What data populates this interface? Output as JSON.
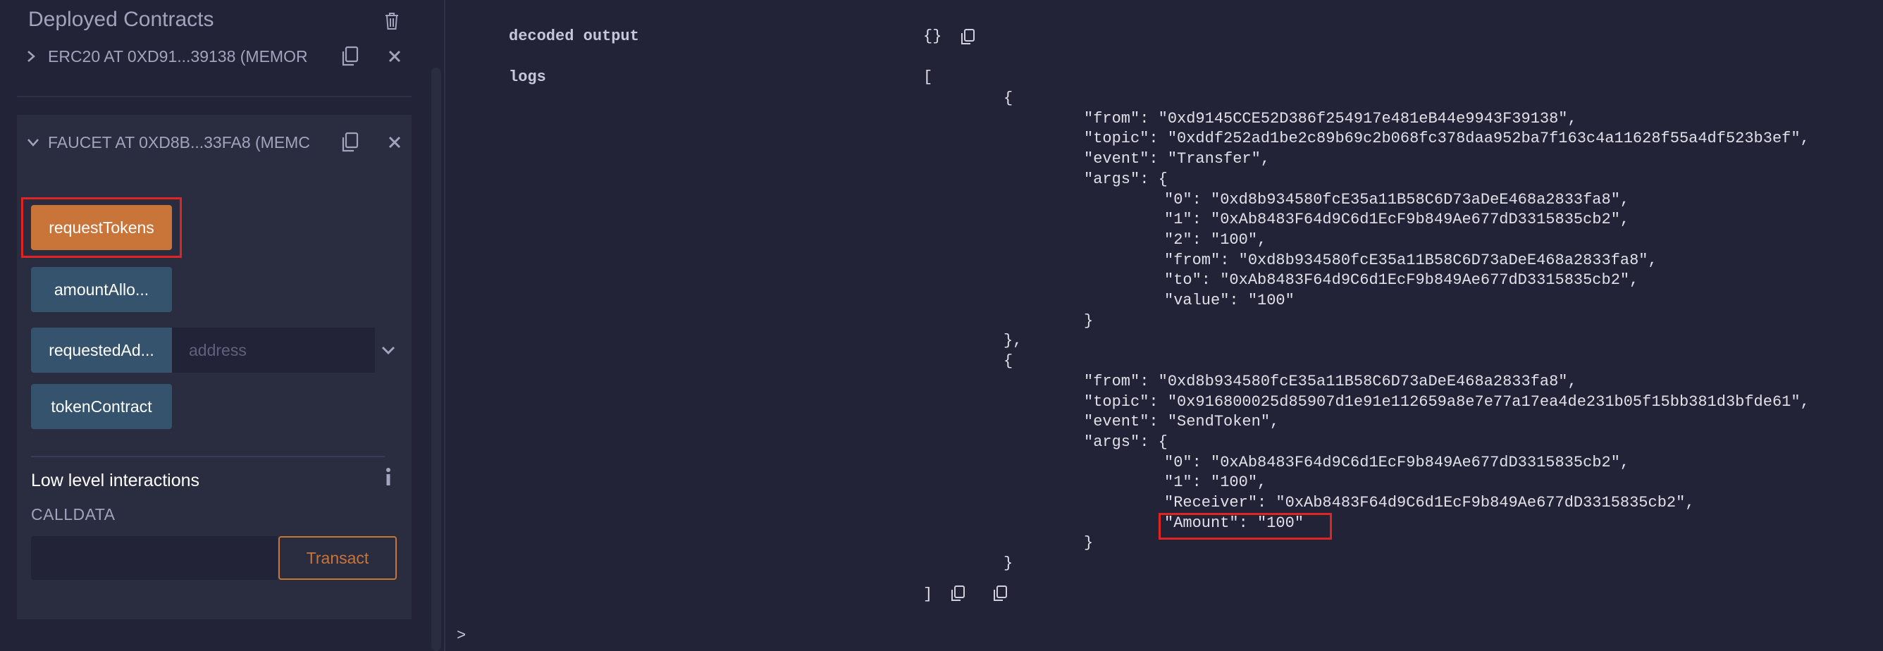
{
  "sidebar": {
    "title": "Deployed Contracts",
    "contracts": [
      {
        "label": "ERC20 AT 0XD91...39138 (MEMOR",
        "expanded": false
      },
      {
        "label": "FAUCET AT 0XD8B...33FA8 (MEMC",
        "expanded": true
      }
    ],
    "functions": [
      {
        "label": "requestTokens",
        "color": "orange",
        "highlighted": true
      },
      {
        "label": "amountAllo...",
        "color": "blue"
      },
      {
        "label": "requestedAd...",
        "color": "blue",
        "input_placeholder": "address"
      },
      {
        "label": "tokenContract",
        "color": "blue"
      }
    ],
    "low_level": {
      "title": "Low level interactions",
      "calldata_label": "CALLDATA",
      "transact_label": "Transact"
    }
  },
  "terminal": {
    "decoded_output_label": "decoded output",
    "decoded_output_value": "{}",
    "logs_label": "logs",
    "logs_open": "[",
    "logs_close": "]",
    "prompt": ">",
    "lines": [
      {
        "indent": 1,
        "text": "{"
      },
      {
        "indent": 2,
        "text": "\"from\": \"0xd9145CCE52D386f254917e481eB44e9943F39138\","
      },
      {
        "indent": 2,
        "text": "\"topic\": \"0xddf252ad1be2c89b69c2b068fc378daa952ba7f163c4a11628f55a4df523b3ef\","
      },
      {
        "indent": 2,
        "text": "\"event\": \"Transfer\","
      },
      {
        "indent": 2,
        "text": "\"args\": {"
      },
      {
        "indent": 3,
        "text": "\"0\": \"0xd8b934580fcE35a11B58C6D73aDeE468a2833fa8\","
      },
      {
        "indent": 3,
        "text": "\"1\": \"0xAb8483F64d9C6d1EcF9b849Ae677dD3315835cb2\","
      },
      {
        "indent": 3,
        "text": "\"2\": \"100\","
      },
      {
        "indent": 3,
        "text": "\"from\": \"0xd8b934580fcE35a11B58C6D73aDeE468a2833fa8\","
      },
      {
        "indent": 3,
        "text": "\"to\": \"0xAb8483F64d9C6d1EcF9b849Ae677dD3315835cb2\","
      },
      {
        "indent": 3,
        "text": "\"value\": \"100\""
      },
      {
        "indent": 2,
        "text": "}"
      },
      {
        "indent": 1,
        "text": "},"
      },
      {
        "indent": 1,
        "text": "{"
      },
      {
        "indent": 2,
        "text": "\"from\": \"0xd8b934580fcE35a11B58C6D73aDeE468a2833fa8\","
      },
      {
        "indent": 2,
        "text": "\"topic\": \"0x916800025d85907d1e91e112659a8e7e77a17ea4de231b05f15bb381d3bfde61\","
      },
      {
        "indent": 2,
        "text": "\"event\": \"SendToken\","
      },
      {
        "indent": 2,
        "text": "\"args\": {"
      },
      {
        "indent": 3,
        "text": "\"0\": \"0xAb8483F64d9C6d1EcF9b849Ae677dD3315835cb2\","
      },
      {
        "indent": 3,
        "text": "\"1\": \"100\","
      },
      {
        "indent": 3,
        "text": "\"Receiver\": \"0xAb8483F64d9C6d1EcF9b849Ae677dD3315835cb2\","
      },
      {
        "indent": 3,
        "text": "\"Amount\": \"100\"",
        "highlighted": true
      },
      {
        "indent": 2,
        "text": "}"
      },
      {
        "indent": 1,
        "text": "}"
      }
    ]
  },
  "colors": {
    "background": "#222336",
    "panel": "#2a2c3f",
    "orange": "#c97539",
    "blue": "#35536c",
    "highlight_border": "#e02424",
    "text_muted": "#a2a3bd"
  },
  "icons": [
    "trash-icon",
    "chevron-right-icon",
    "chevron-down-icon",
    "copy-icon",
    "close-icon",
    "info-icon"
  ]
}
